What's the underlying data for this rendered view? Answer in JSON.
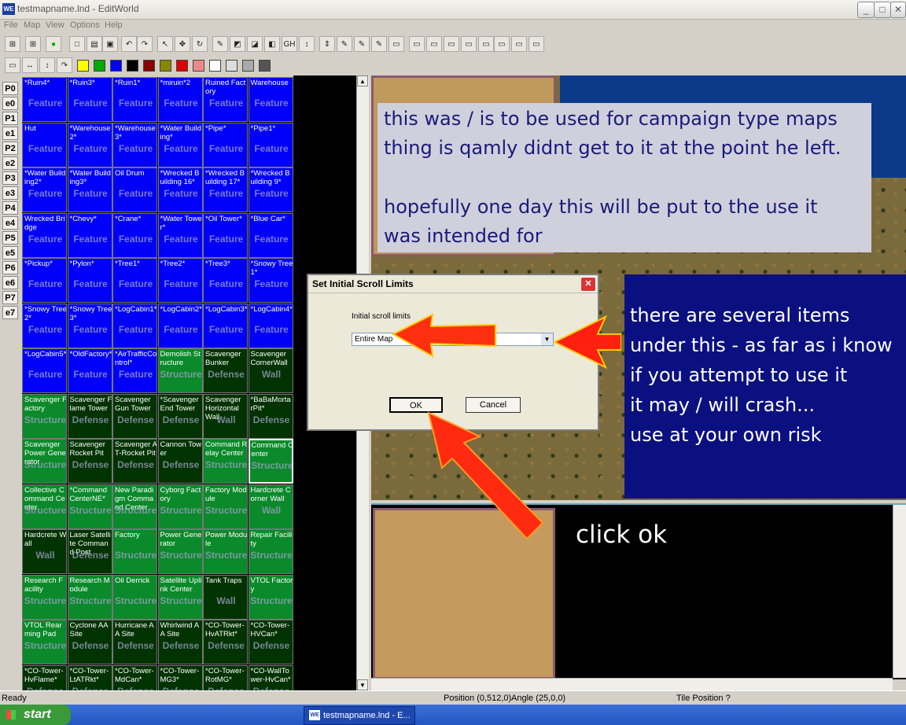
{
  "window": {
    "title": "testmapname.lnd - EditWorld",
    "app_icon": "WE"
  },
  "menu": [
    "File",
    "Map",
    "View",
    "Options",
    "Help"
  ],
  "toolbar1": [
    "map",
    "map",
    "on",
    "new",
    "open",
    "save",
    "undo",
    "redo",
    "sel",
    "move",
    "rot",
    "pen",
    "fill",
    "fill2",
    "fill3",
    "GH",
    "h1",
    "h2",
    "p1",
    "p2",
    "p3",
    "b1",
    "b2",
    "b3",
    "b4",
    "b5",
    "b6",
    "b7",
    "b8",
    "b9"
  ],
  "toolbar2_colors": [
    "#ffff00",
    "#00aa00",
    "#0000ff",
    "#000000",
    "#880000",
    "#888800",
    "#dd0000",
    "#ee8888",
    "#ffffff",
    "#dddddd",
    "#aaaaaa",
    "#555555"
  ],
  "side_tabs": [
    "P0",
    "e0",
    "P1",
    "e1",
    "P2",
    "e2",
    "P3",
    "e3",
    "P4",
    "e4",
    "P5",
    "e5",
    "P6",
    "e6",
    "P7",
    "e7"
  ],
  "grid": [
    {
      "name": "*Ruin4*",
      "type": "Feature",
      "color": "blue"
    },
    {
      "name": "*Ruin3*",
      "type": "Feature",
      "color": "blue"
    },
    {
      "name": "*Ruin1*",
      "type": "Feature",
      "color": "blue"
    },
    {
      "name": "*miruin*2",
      "type": "Feature",
      "color": "blue"
    },
    {
      "name": "Ruined Factory",
      "type": "Feature",
      "color": "blue"
    },
    {
      "name": "Warehouse",
      "type": "Feature",
      "color": "blue"
    },
    {
      "name": "Hut",
      "type": "Feature",
      "color": "blue"
    },
    {
      "name": "*Warehouse2*",
      "type": "Feature",
      "color": "blue"
    },
    {
      "name": "*Warehouse3*",
      "type": "Feature",
      "color": "blue"
    },
    {
      "name": "*Water Building*",
      "type": "Feature",
      "color": "blue"
    },
    {
      "name": "*Pipe*",
      "type": "Feature",
      "color": "blue"
    },
    {
      "name": "*Pipe1*",
      "type": "Feature",
      "color": "blue"
    },
    {
      "name": "*Water Building2*",
      "type": "Feature",
      "color": "blue"
    },
    {
      "name": "*Water Building3*",
      "type": "Feature",
      "color": "blue"
    },
    {
      "name": "Oil Drum",
      "type": "Feature",
      "color": "blue"
    },
    {
      "name": "*Wrecked Building 16*",
      "type": "Feature",
      "color": "blue"
    },
    {
      "name": "*Wrecked Building 17*",
      "type": "Feature",
      "color": "blue"
    },
    {
      "name": "*Wrecked Building 9*",
      "type": "Feature",
      "color": "blue"
    },
    {
      "name": "Wrecked Bridge",
      "type": "Feature",
      "color": "blue"
    },
    {
      "name": "*Chevy*",
      "type": "Feature",
      "color": "blue"
    },
    {
      "name": "*Crane*",
      "type": "Feature",
      "color": "blue"
    },
    {
      "name": "*Water Tower*",
      "type": "Feature",
      "color": "blue"
    },
    {
      "name": "*Oil Tower*",
      "type": "Feature",
      "color": "blue"
    },
    {
      "name": "*Blue Car*",
      "type": "Feature",
      "color": "blue"
    },
    {
      "name": "*Pickup*",
      "type": "Feature",
      "color": "blue"
    },
    {
      "name": "*Pylon*",
      "type": "Feature",
      "color": "blue"
    },
    {
      "name": "*Tree1*",
      "type": "Feature",
      "color": "blue"
    },
    {
      "name": "*Tree2*",
      "type": "Feature",
      "color": "blue"
    },
    {
      "name": "*Tree3*",
      "type": "Feature",
      "color": "blue"
    },
    {
      "name": "*Snowy Tree1*",
      "type": "Feature",
      "color": "blue"
    },
    {
      "name": "*Snowy Tree2*",
      "type": "Feature",
      "color": "blue"
    },
    {
      "name": "*Snowy Tree3*",
      "type": "Feature",
      "color": "blue"
    },
    {
      "name": "*LogCabin1*",
      "type": "Feature",
      "color": "blue"
    },
    {
      "name": "*LogCabin2*",
      "type": "Feature",
      "color": "blue"
    },
    {
      "name": "*LogCabin3*",
      "type": "Feature",
      "color": "blue"
    },
    {
      "name": "*LogCabin4*",
      "type": "Feature",
      "color": "blue"
    },
    {
      "name": "*LogCabin5*",
      "type": "Feature",
      "color": "blue"
    },
    {
      "name": "*OldFactory*",
      "type": "Feature",
      "color": "blue"
    },
    {
      "name": "*AirTrafficControl*",
      "type": "Feature",
      "color": "blue"
    },
    {
      "name": "Demolish Structure",
      "type": "Structure",
      "color": "green"
    },
    {
      "name": "Scavenger Bunker",
      "type": "Defense",
      "color": "dark"
    },
    {
      "name": "Scavenger CornerWall",
      "type": "Wall",
      "color": "dark"
    },
    {
      "name": "Scavenger Factory",
      "type": "Structure",
      "color": "green"
    },
    {
      "name": "Scavenger Flame Tower",
      "type": "Defense",
      "color": "dark"
    },
    {
      "name": "Scavenger Gun Tower",
      "type": "Defense",
      "color": "dark"
    },
    {
      "name": "*Scavenger End Tower",
      "type": "Defense",
      "color": "dark"
    },
    {
      "name": "Scavenger Horizontal Wall",
      "type": "Wall",
      "color": "dark"
    },
    {
      "name": "*BaBaMortarPit*",
      "type": "Defense",
      "color": "dark"
    },
    {
      "name": "Scavenger Power Generator",
      "type": "Structure",
      "color": "green"
    },
    {
      "name": "Scavenger Rocket Pit",
      "type": "Defense",
      "color": "dark"
    },
    {
      "name": "Scavenger AT-Rocket Pit",
      "type": "Defense",
      "color": "dark"
    },
    {
      "name": "Cannon Tower",
      "type": "Defense",
      "color": "dark"
    },
    {
      "name": "Command Relay Center",
      "type": "Structure",
      "color": "green"
    },
    {
      "name": "Command Center",
      "type": "Structure",
      "color": "green",
      "selected": true
    },
    {
      "name": "Collective Command Center",
      "type": "Structure",
      "color": "green"
    },
    {
      "name": "*Command CenterNE*",
      "type": "Structure",
      "color": "green"
    },
    {
      "name": "New Paradigm Command Center",
      "type": "Structure",
      "color": "green"
    },
    {
      "name": "Cyborg Factory",
      "type": "Structure",
      "color": "green"
    },
    {
      "name": "Factory Module",
      "type": "Structure",
      "color": "green"
    },
    {
      "name": "Hardcrete Corner Wall",
      "type": "Wall",
      "color": "green"
    },
    {
      "name": "Hardcrete Wall",
      "type": "Wall",
      "color": "dark"
    },
    {
      "name": "Laser Satellite Command Post",
      "type": "Defense",
      "color": "dark"
    },
    {
      "name": "Factory",
      "type": "Structure",
      "color": "green"
    },
    {
      "name": "Power Generator",
      "type": "Structure",
      "color": "green"
    },
    {
      "name": "Power Module",
      "type": "Structure",
      "color": "green"
    },
    {
      "name": "Repair Facility",
      "type": "Structure",
      "color": "green"
    },
    {
      "name": "Research Facility",
      "type": "Structure",
      "color": "green"
    },
    {
      "name": "Research Module",
      "type": "Structure",
      "color": "green"
    },
    {
      "name": "Oil Derrick",
      "type": "Structure",
      "color": "green"
    },
    {
      "name": "Satellite Uplink Center",
      "type": "Structure",
      "color": "green"
    },
    {
      "name": "Tank Traps",
      "type": "Wall",
      "color": "dark"
    },
    {
      "name": "VTOL Factory",
      "type": "Structure",
      "color": "green"
    },
    {
      "name": "VTOL Rearming Pad",
      "type": "Structure",
      "color": "green"
    },
    {
      "name": "Cyclone AA Site",
      "type": "Defense",
      "color": "dark"
    },
    {
      "name": "Hurricane AA Site",
      "type": "Defense",
      "color": "dark"
    },
    {
      "name": "Whirlwind AA Site",
      "type": "Defense",
      "color": "dark"
    },
    {
      "name": "*CO-Tower-HvATRkt*",
      "type": "Defense",
      "color": "dark"
    },
    {
      "name": "*CO-Tower-HVCan*",
      "type": "Defense",
      "color": "dark"
    },
    {
      "name": "*CO-Tower-HvFlame*",
      "type": "Defense",
      "color": "dark"
    },
    {
      "name": "*CO-Tower-LtATRkt*",
      "type": "Defense",
      "color": "dark"
    },
    {
      "name": "*CO-Tower-MdCan*",
      "type": "Defense",
      "color": "dark"
    },
    {
      "name": "*CO-Tower-MG3*",
      "type": "Defense",
      "color": "dark"
    },
    {
      "name": "*CO-Tower-RotMG*",
      "type": "Defense",
      "color": "dark"
    },
    {
      "name": "*CO-WallTower-HvCan*",
      "type": "Defense",
      "color": "dark"
    }
  ],
  "notes": {
    "top_line1": "this was / is to be used for campaign type maps",
    "top_line2": "thing is qamly didnt get to it at the point he left.",
    "top_line3": "hopefully one day this will be put to the use it",
    "top_line4": "was intended for",
    "right_line1": "there are several items",
    "right_line2": "under this - as far as i know",
    "right_line3": "if you attempt to use it",
    "right_line4": "it may / will crash...",
    "right_line5": "use at your own risk",
    "click": "click ok"
  },
  "dialog": {
    "title": "Set Initial Scroll Limits",
    "label": "Initial scroll limits",
    "select_value": "Entire Map",
    "ok": "OK",
    "cancel": "Cancel"
  },
  "status": {
    "left": "Ready",
    "position": "Position (0,512,0)",
    "angle": "Angle (25,0,0)",
    "tile": "Tile Position ?"
  },
  "taskbar": {
    "start": "start",
    "task": "testmapname.lnd - E..."
  }
}
